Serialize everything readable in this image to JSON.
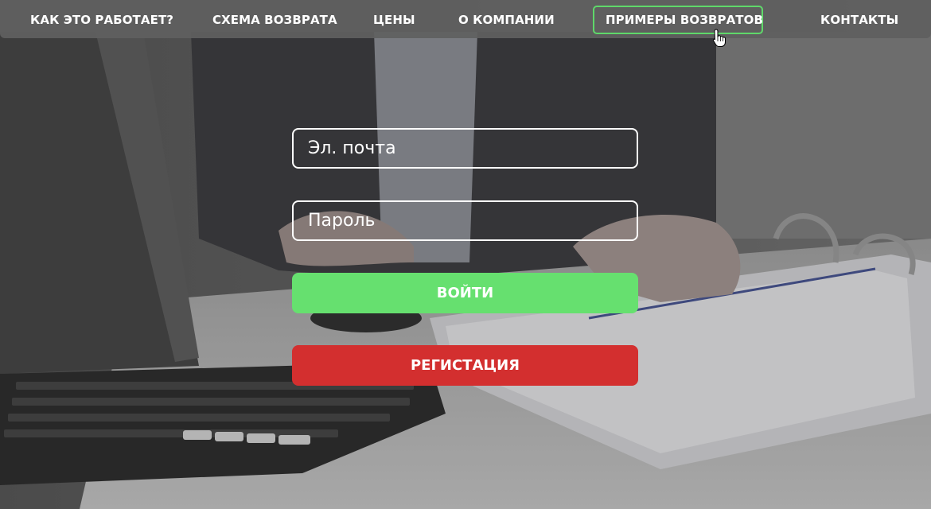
{
  "nav": {
    "items": [
      {
        "label": "КАК ЭТО РАБОТАЕТ?"
      },
      {
        "label": "СХЕМА ВОЗВРАТА"
      },
      {
        "label": "ЦЕНЫ"
      },
      {
        "label": "О КОМПАНИИ"
      },
      {
        "label": "ПРИМЕРЫ ВОЗВРАТОВ",
        "active": true
      },
      {
        "label": "КОНТАКТЫ"
      }
    ]
  },
  "form": {
    "email_placeholder": "Эл. почта",
    "password_placeholder": "Пароль",
    "login_label": "ВОЙТИ",
    "register_label": "РЕГИСТАЦИЯ"
  },
  "colors": {
    "accent_green": "#66e06f",
    "active_border": "#5fd86a",
    "register_red": "#d32f2f",
    "nav_bg": "#5f5f5f"
  }
}
